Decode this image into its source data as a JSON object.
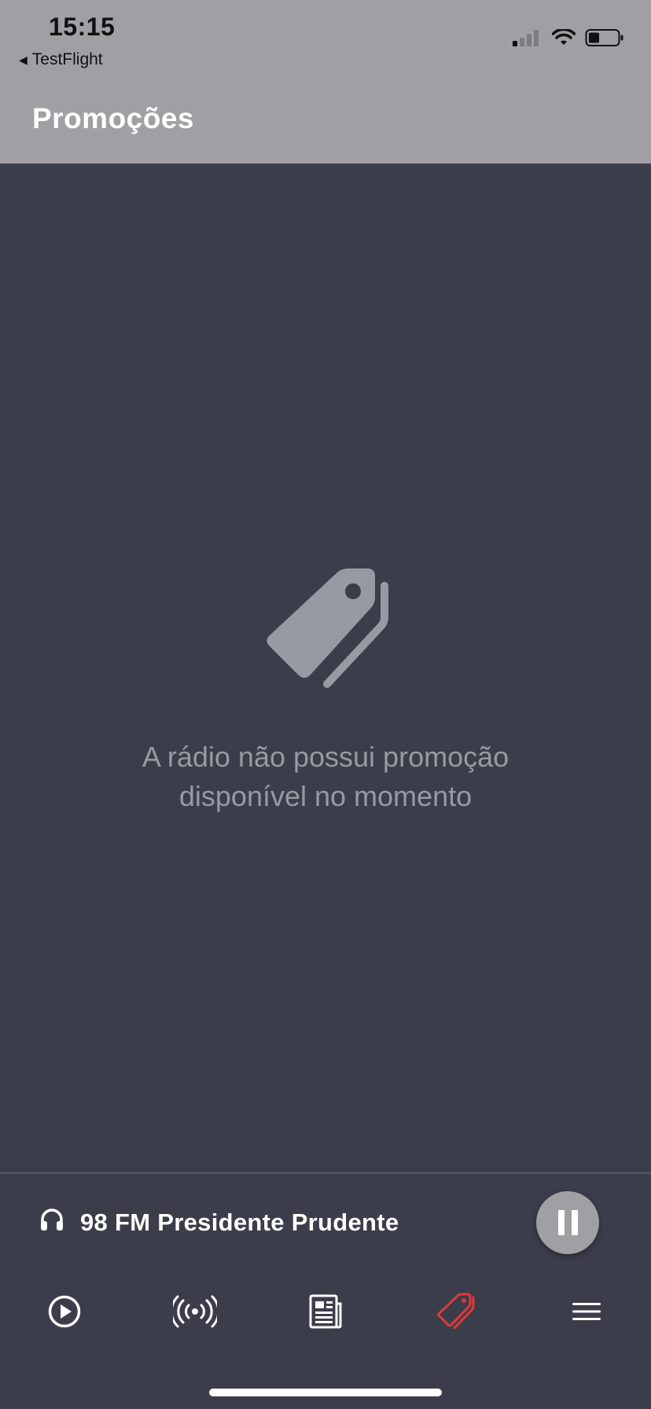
{
  "status_bar": {
    "time": "15:15",
    "back_app": "TestFlight",
    "icons": [
      "signal-icon",
      "wifi-icon",
      "battery-icon"
    ]
  },
  "header": {
    "title": "Promoções"
  },
  "empty_state": {
    "icon": "tags-icon",
    "line1": "A rádio não possui promoção",
    "line2": "disponível no momento"
  },
  "player": {
    "icon": "headphones-icon",
    "station": "98 FM Presidente Prudente",
    "button_icon": "pause-icon"
  },
  "tabs": [
    {
      "icon": "play-circle-icon",
      "active": false
    },
    {
      "icon": "broadcast-icon",
      "active": false
    },
    {
      "icon": "newspaper-icon",
      "active": false
    },
    {
      "icon": "tags-icon",
      "active": true
    },
    {
      "icon": "menu-icon",
      "active": false
    }
  ],
  "colors": {
    "header_bg": "#a09fa3",
    "content_bg": "#3b3e4a",
    "accent": "#e0393b",
    "muted_text": "#979aa3"
  }
}
